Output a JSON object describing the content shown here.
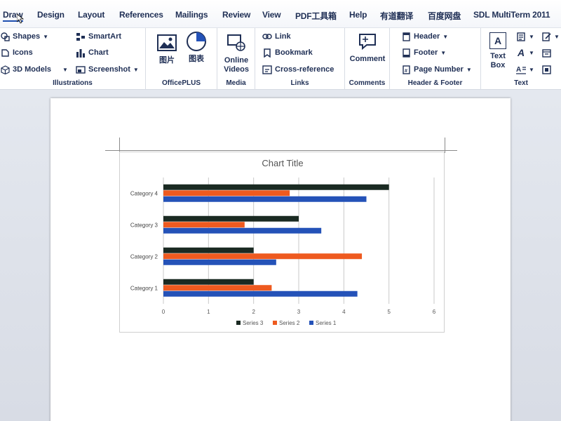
{
  "menu": {
    "tabs": [
      "Draw",
      "Design",
      "Layout",
      "References",
      "Mailings",
      "Review",
      "View",
      "PDF工具箱",
      "Help",
      "有道翻译",
      "百度网盘",
      "SDL MultiTerm 2011"
    ],
    "active": "Draw"
  },
  "ribbon": {
    "illustrations": {
      "shapes": "Shapes",
      "icons": "Icons",
      "models": "3D Models",
      "smartart": "SmartArt",
      "chart": "Chart",
      "screenshot": "Screenshot",
      "label": "Illustrations"
    },
    "officeplus": {
      "picture": "图片",
      "chart": "图表",
      "label": "OfficePLUS"
    },
    "media": {
      "online_videos_1": "Online",
      "online_videos_2": "Videos",
      "label": "Media"
    },
    "links": {
      "link": "Link",
      "bookmark": "Bookmark",
      "crossref": "Cross-reference",
      "label": "Links"
    },
    "comments": {
      "comment": "Comment",
      "label": "Comments"
    },
    "header_footer": {
      "header": "Header",
      "footer": "Footer",
      "page_number": "Page Number",
      "label": "Header & Footer"
    },
    "text": {
      "textbox_1": "Text",
      "textbox_2": "Box",
      "label": "Text"
    }
  },
  "chart_data": {
    "type": "bar",
    "orientation": "horizontal",
    "title": "Chart Title",
    "categories": [
      "Category 1",
      "Category 2",
      "Category 3",
      "Category 4"
    ],
    "series": [
      {
        "name": "Series 1",
        "values": [
          4.3,
          2.5,
          3.5,
          4.5
        ],
        "color": "#2452b8"
      },
      {
        "name": "Series 2",
        "values": [
          2.4,
          4.4,
          1.8,
          2.8
        ],
        "color": "#ee5a1f"
      },
      {
        "name": "Series 3",
        "values": [
          2,
          2,
          3,
          5
        ],
        "color": "#1a2a22"
      }
    ],
    "xlim": [
      0,
      6
    ],
    "xticks": [
      "0",
      "1",
      "2",
      "3",
      "4",
      "5",
      "6"
    ],
    "grid": true,
    "legend": "bottom"
  }
}
